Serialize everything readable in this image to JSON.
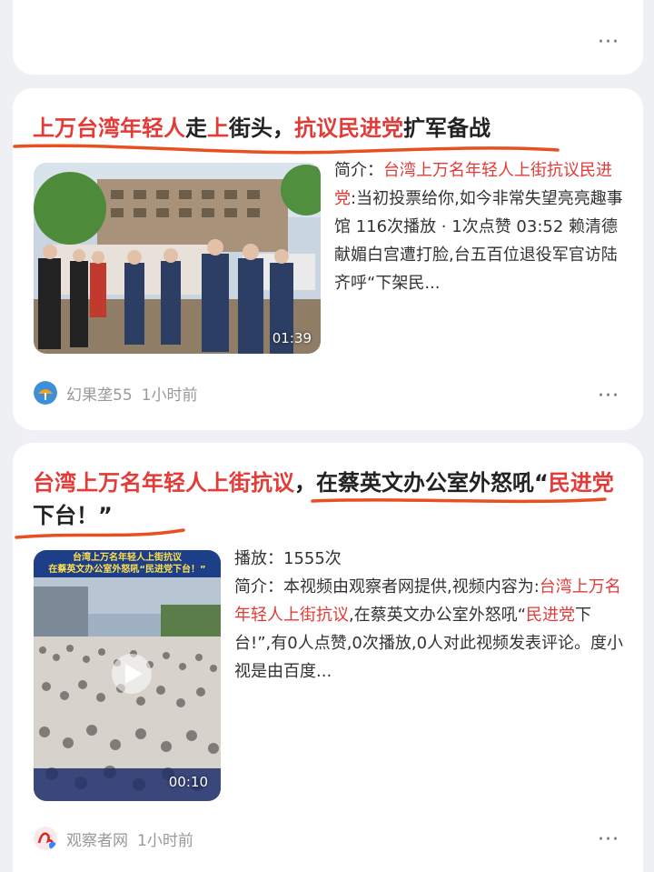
{
  "card1": {
    "title_parts": [
      "上万台湾年轻人",
      "走",
      "上",
      "街头，",
      "抗议民进党",
      "扩军备战"
    ],
    "summary_label": "简介：",
    "summary_hl1": "台湾上万名年轻人上街抗议",
    "summary_hl2": "民进党",
    "summary_rest": ":当初投票给你,如今非常失望亮亮趣事馆 116次播放 · 1次点赞 03:52 赖清德献媚白宫遭打脸,台五百位退役军官访陆齐呼“下架民...",
    "duration": "01:39",
    "author": "幻果垄55",
    "time": "1小时前",
    "more": "···"
  },
  "card2": {
    "title_hl1": "台湾上万名年轻人上街抗议",
    "title_mid": "，在蔡英文办公室外怒吼“",
    "title_hl2": "民进党",
    "title_end": "下台！”",
    "plays": "播放：1555次",
    "summary_label": "简介：",
    "summary_pre": "本视频由观察者网提供,视频内容为:",
    "summary_hl1": "台湾上万名年轻人上街抗议",
    "summary_mid": ",在蔡英文办公室外怒吼“",
    "summary_hl2": "民进党",
    "summary_rest": "下台!”,有0人点赞,0次播放,0人对此视频发表评论。度小视是由百度...",
    "thumb_caption1": "台湾上万名年轻人上街抗议",
    "thumb_caption2": "在蔡英文办公室外怒吼“民进党下台！”",
    "duration": "00:10",
    "author": "观察者网",
    "time": "1小时前",
    "more": "···"
  },
  "card0": {
    "more": "···"
  },
  "colors": {
    "highlight": "#e33b37",
    "underline": "#e8501f"
  }
}
